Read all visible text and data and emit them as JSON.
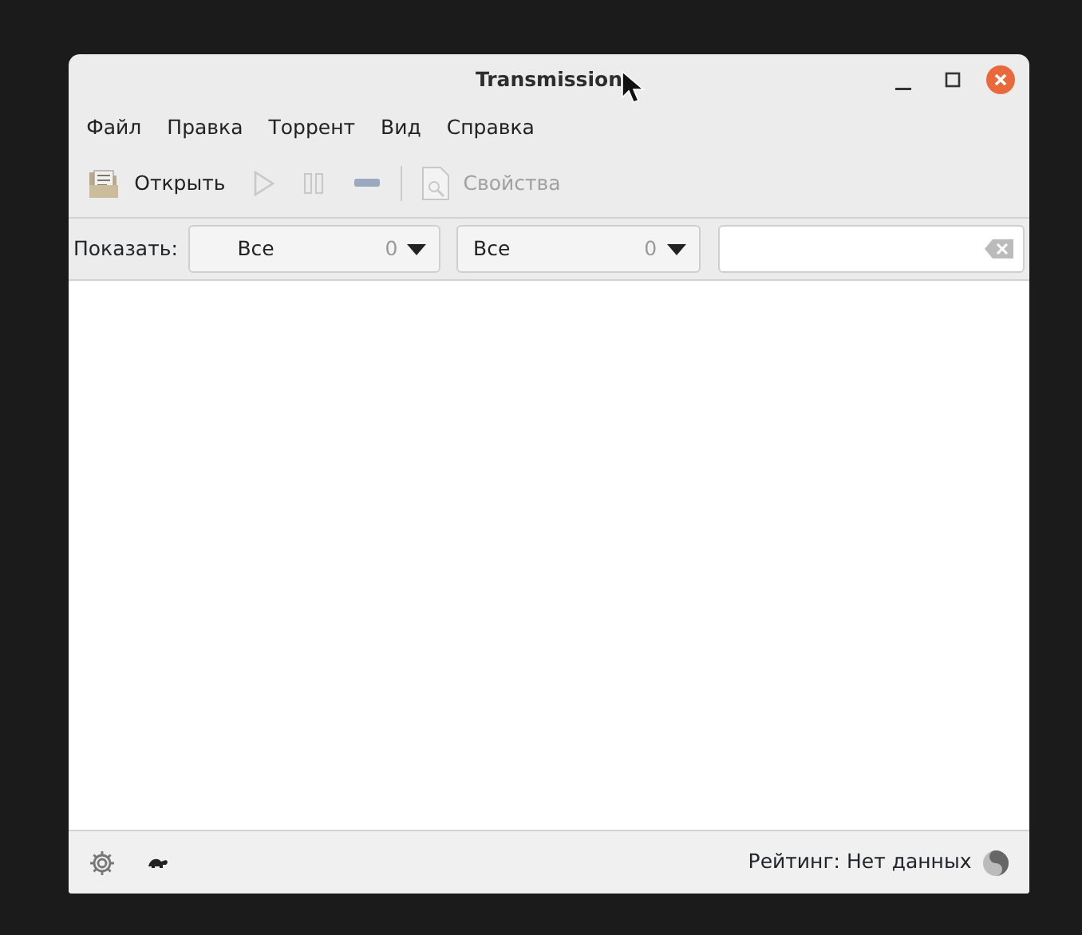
{
  "window": {
    "title": "Transmission"
  },
  "menu": [
    "Файл",
    "Правка",
    "Торрент",
    "Вид",
    "Справка"
  ],
  "toolbar": [
    {
      "kind": "open",
      "label": "Открыть",
      "disabled": false
    },
    {
      "kind": "start",
      "disabled": true
    },
    {
      "kind": "pause",
      "disabled": true
    },
    {
      "kind": "remove",
      "disabled": true
    },
    {
      "kind": "separator"
    },
    {
      "kind": "properties",
      "label": "Свойства",
      "disabled": true
    }
  ],
  "filter": {
    "label": "Показать:",
    "combos": [
      {
        "value": "Все",
        "count": "0"
      },
      {
        "value": "Все",
        "count": "0"
      }
    ]
  },
  "status_bar": {
    "ratio": "Рейтинг: Нет данных"
  }
}
